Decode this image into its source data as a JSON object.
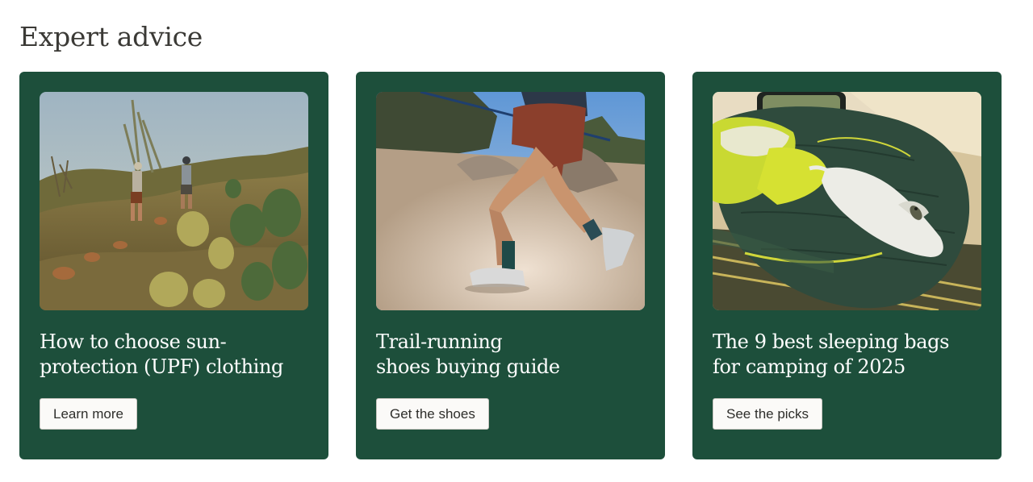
{
  "section": {
    "title": "Expert advice"
  },
  "cards": [
    {
      "image": "hikers-in-desert-photo",
      "title_line1": "How to choose sun-",
      "title_line2": "protection (UPF) clothing",
      "button_label": "Learn more"
    },
    {
      "image": "trail-runner-photo",
      "title_line1": "Trail-running",
      "title_line2": "shoes buying guide",
      "button_label": "Get the shoes"
    },
    {
      "image": "dog-on-sleeping-bag-photo",
      "title_line1": "The 9 best sleeping bags",
      "title_line2": "for camping of 2025",
      "button_label": "See the picks"
    }
  ],
  "colors": {
    "card_background": "#1d4f3b",
    "button_background": "#fbfaf8",
    "title_text": "#3b3a36"
  }
}
